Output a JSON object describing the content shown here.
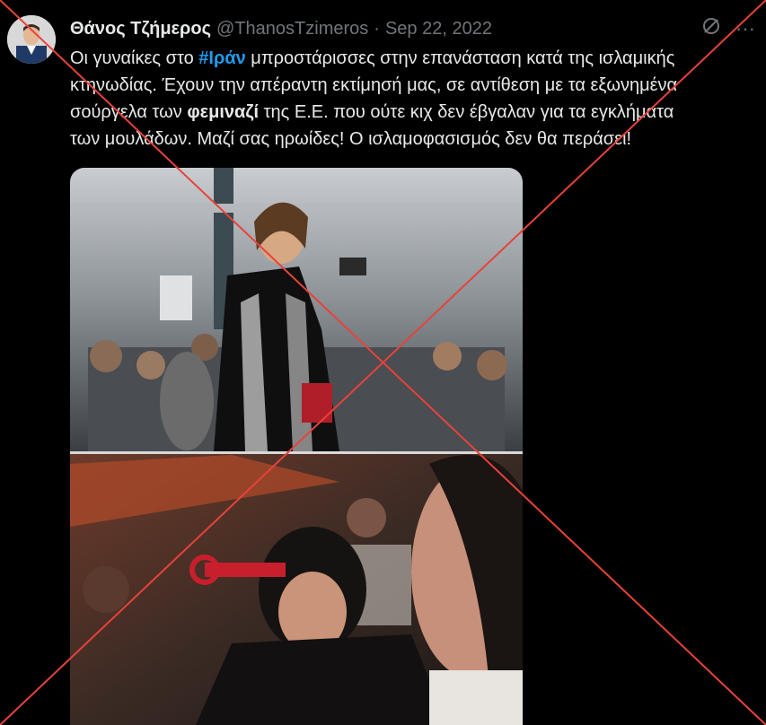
{
  "tweet": {
    "author_name": "Θάνος Τζήμερος",
    "handle": "@ThanosTzimeros",
    "separator": "·",
    "date": "Sep 22, 2022",
    "line1_pre": "Οι γυναίκες στο ",
    "line1_hashtag": "#Ιράν",
    "line1_post": " μπροστάρισσες στην επανάσταση κατά της ισλαμικής",
    "line2": "κτηνωδίας. Έχουν την απέραντη εκτίμησή μας, σε αντίθεση με τα εξωνημένα",
    "line3_pre": "σούργελα των ",
    "line3_bold": "φεμιναζί",
    "line3_post": " της Ε.Ε. που ούτε κιχ δεν έβγαλαν για τα εγκλήματα",
    "line4": "των μουλάδων. Μαζί σας ηρωίδες! Ο ισλαμοφασισμός δεν θα περάσει!"
  },
  "icons": {
    "avatar": "profile-avatar",
    "grok": "slash-circle-icon",
    "more": "more-icon",
    "more_glyph": "···"
  },
  "overlay": {
    "cross_color": "#e8423b"
  },
  "colors": {
    "background": "#000000",
    "text": "#e7e9ea",
    "muted": "#71767b",
    "hashtag": "#1d9bf0"
  }
}
